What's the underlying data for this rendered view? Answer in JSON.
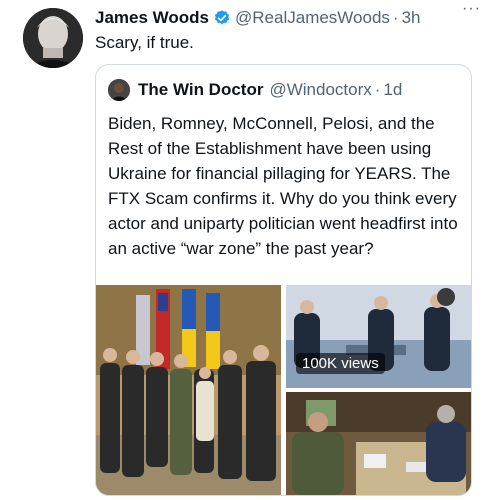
{
  "author": {
    "name": "James Woods",
    "handle": "@RealJamesWoods",
    "separator": "·",
    "time": "3h",
    "more": "···"
  },
  "tweet": {
    "text": "Scary, if true."
  },
  "quoted": {
    "name": "The Win Doctor",
    "handle": "@Windoctorx",
    "separator": "·",
    "time": "1d",
    "text": "Biden, Romney, McConnell, Pelosi, and the Rest of the Establishment have been using Ukraine for financial pillaging for YEARS. The FTX Scam confirms it. Why do you think every actor and uniparty politician went headfirst into an active “war zone” the past year?",
    "media": {
      "video_views": "100K views"
    }
  },
  "colors": {
    "verified": "#1d9bf0",
    "secondary_text": "#536471",
    "border": "#cfd9de"
  }
}
